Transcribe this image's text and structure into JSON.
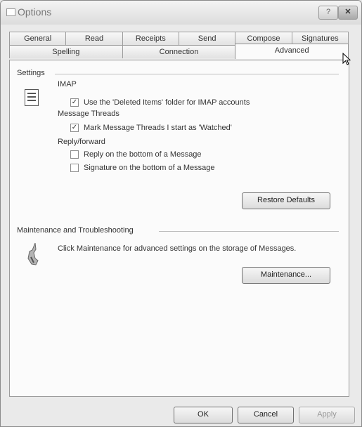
{
  "window": {
    "title": "Options",
    "help_label": "?",
    "close_label": "✕"
  },
  "tabs_row1": [
    "General",
    "Read",
    "Receipts",
    "Send",
    "Compose",
    "Signatures"
  ],
  "tabs_row2": [
    "Spelling",
    "Connection",
    "Advanced"
  ],
  "active_tab": "Advanced",
  "settings": {
    "group_label": "Settings",
    "imap": {
      "heading": "IMAP",
      "deleted_items": {
        "label": "Use the 'Deleted Items' folder for IMAP accounts",
        "checked": true
      }
    },
    "threads": {
      "heading": "Message Threads",
      "mark_watched": {
        "label": "Mark Message Threads I start as 'Watched'",
        "checked": true
      }
    },
    "reply": {
      "heading": "Reply/forward",
      "reply_bottom": {
        "label": "Reply on the bottom of a Message",
        "checked": false
      },
      "signature_bottom": {
        "label": "Signature on the bottom of a Message",
        "checked": false
      }
    },
    "restore_defaults": "Restore Defaults"
  },
  "maintenance": {
    "group_label": "Maintenance and Troubleshooting",
    "description": "Click Maintenance for advanced settings on the storage of Messages.",
    "button": "Maintenance..."
  },
  "footer": {
    "ok": "OK",
    "cancel": "Cancel",
    "apply": "Apply"
  },
  "check_glyph": "✓"
}
